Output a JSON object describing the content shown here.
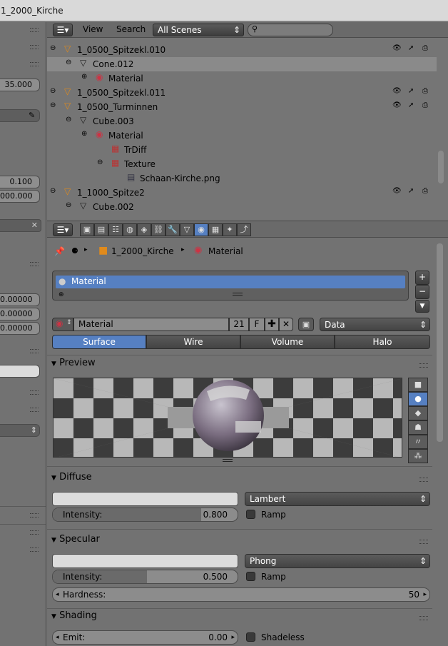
{
  "window": {
    "title": "1_2000_Kirche"
  },
  "left_panel": {
    "values": [
      "35.000",
      "0.100",
      "000.000",
      "0.00000",
      "0.00000",
      "0.00000"
    ]
  },
  "outliner": {
    "menu": {
      "view": "View",
      "search": "Search",
      "scenes": "All Scenes"
    },
    "rows": [
      {
        "label": "Material",
        "indent": 3
      },
      {
        "label": "1_0500_Spitzekl.010",
        "indent": 1
      },
      {
        "label": "Cone.012",
        "indent": 2,
        "selected": true
      },
      {
        "label": "Material",
        "indent": 3
      },
      {
        "label": "1_0500_Spitzekl.011",
        "indent": 1
      },
      {
        "label": "1_0500_Turminnen",
        "indent": 1
      },
      {
        "label": "Cube.003",
        "indent": 2
      },
      {
        "label": "Material",
        "indent": 3
      },
      {
        "label": "TrDiff",
        "indent": 4
      },
      {
        "label": "Texture",
        "indent": 4
      },
      {
        "label": "Schaan-Kirche.png",
        "indent": 5
      },
      {
        "label": "1_1000_Spitze2",
        "indent": 1
      },
      {
        "label": "Cube.002",
        "indent": 2
      }
    ]
  },
  "properties": {
    "breadcrumb": {
      "object": "1_2000_Kirche",
      "material": "Material"
    },
    "slot_list": {
      "selected": "Material"
    },
    "datablock": {
      "name": "Material",
      "users": "21",
      "fake_user": "F",
      "link": "Data"
    },
    "tabs": [
      "Surface",
      "Wire",
      "Volume",
      "Halo"
    ],
    "preview": {
      "title": "Preview"
    },
    "diffuse": {
      "title": "Diffuse",
      "shader": "Lambert",
      "intensity_label": "Intensity:",
      "intensity": "0.800",
      "ramp": "Ramp"
    },
    "specular": {
      "title": "Specular",
      "shader": "Phong",
      "intensity_label": "Intensity:",
      "intensity": "0.500",
      "ramp": "Ramp",
      "hardness_label": "Hardness:",
      "hardness": "50"
    },
    "shading": {
      "title": "Shading",
      "emit_label": "Emit:",
      "emit": "0.00",
      "shadeless": "Shadeless"
    }
  }
}
